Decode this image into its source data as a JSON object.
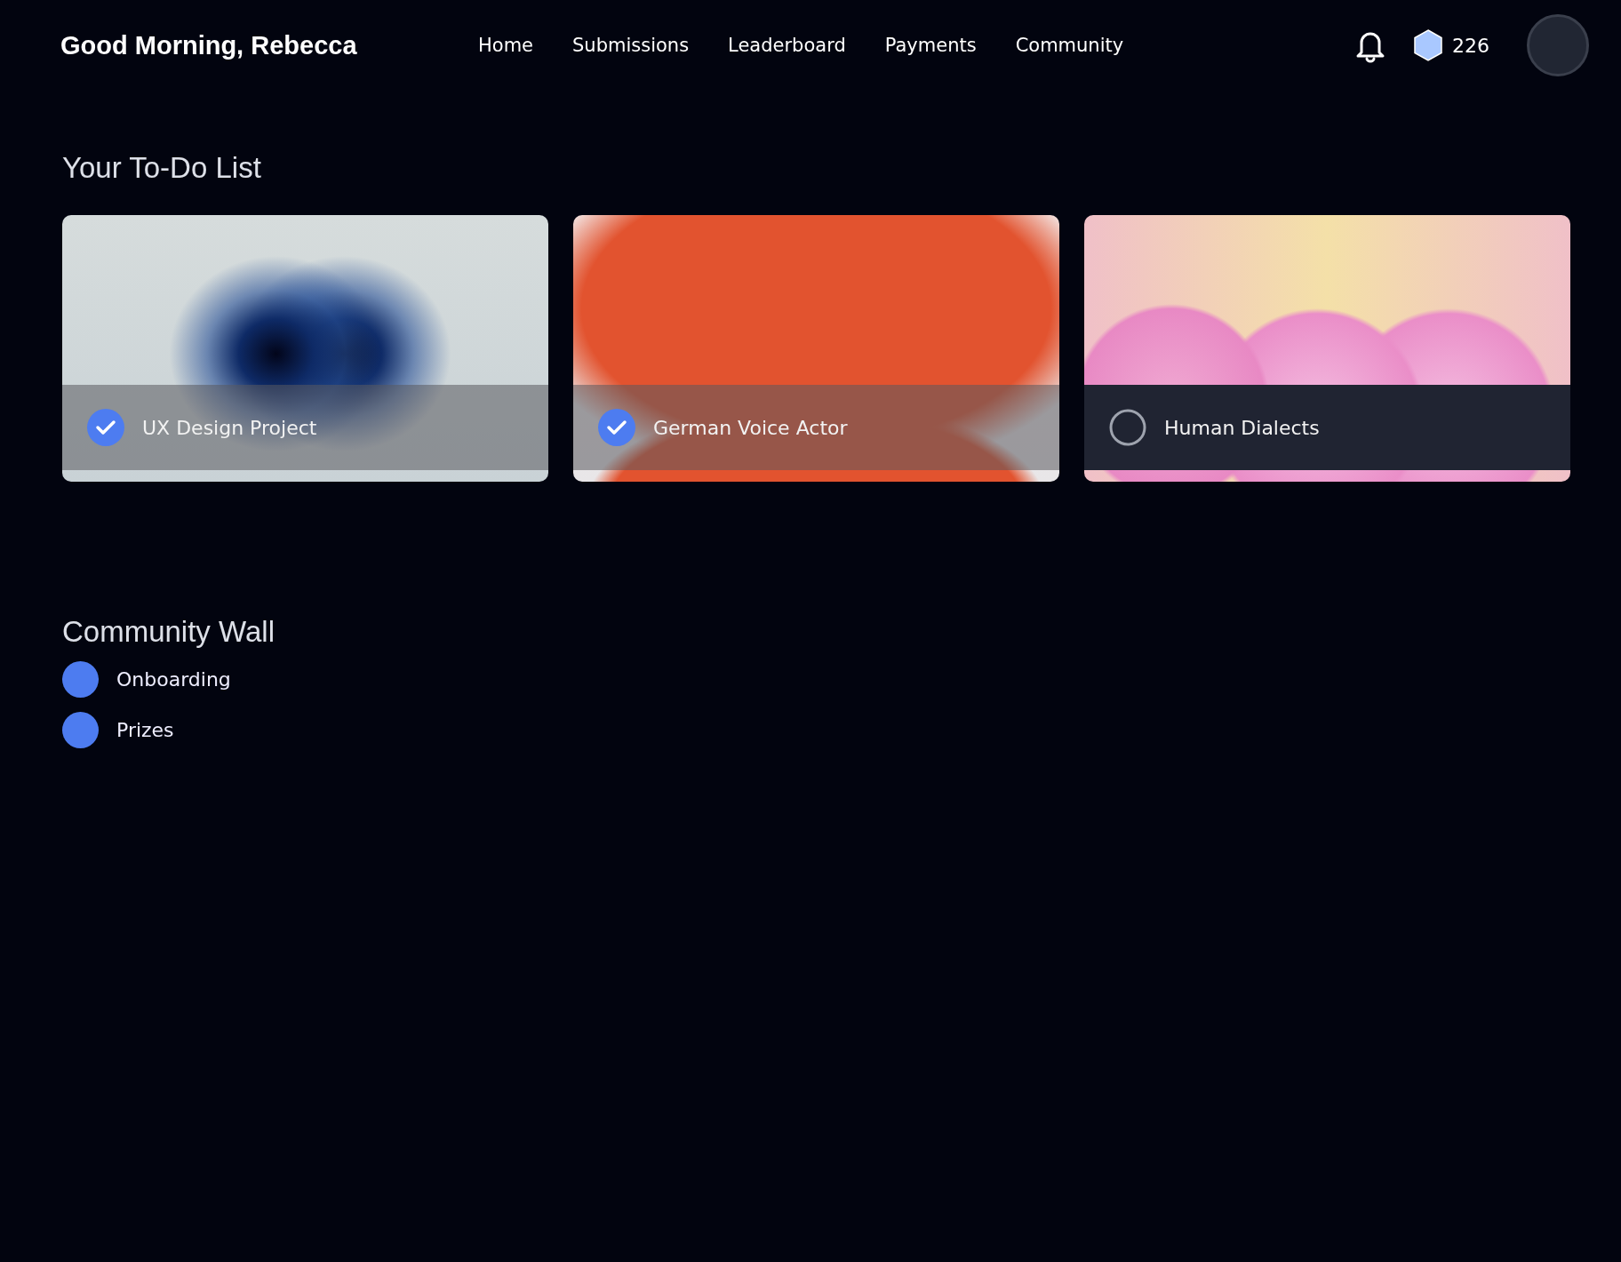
{
  "header": {
    "greeting": "Good Morning, Rebecca",
    "nav": [
      {
        "label": "Home"
      },
      {
        "label": "Submissions"
      },
      {
        "label": "Leaderboard"
      },
      {
        "label": "Payments"
      },
      {
        "label": "Community"
      }
    ],
    "points": "226"
  },
  "todo": {
    "title": "Your To-Do List",
    "items": [
      {
        "label": "UX Design Project",
        "checked": true
      },
      {
        "label": "German Voice Actor",
        "checked": true
      },
      {
        "label": "Human Dialects",
        "checked": false
      }
    ]
  },
  "community": {
    "title": "Community Wall",
    "items": [
      {
        "label": "Onboarding"
      },
      {
        "label": "Prizes"
      }
    ]
  }
}
